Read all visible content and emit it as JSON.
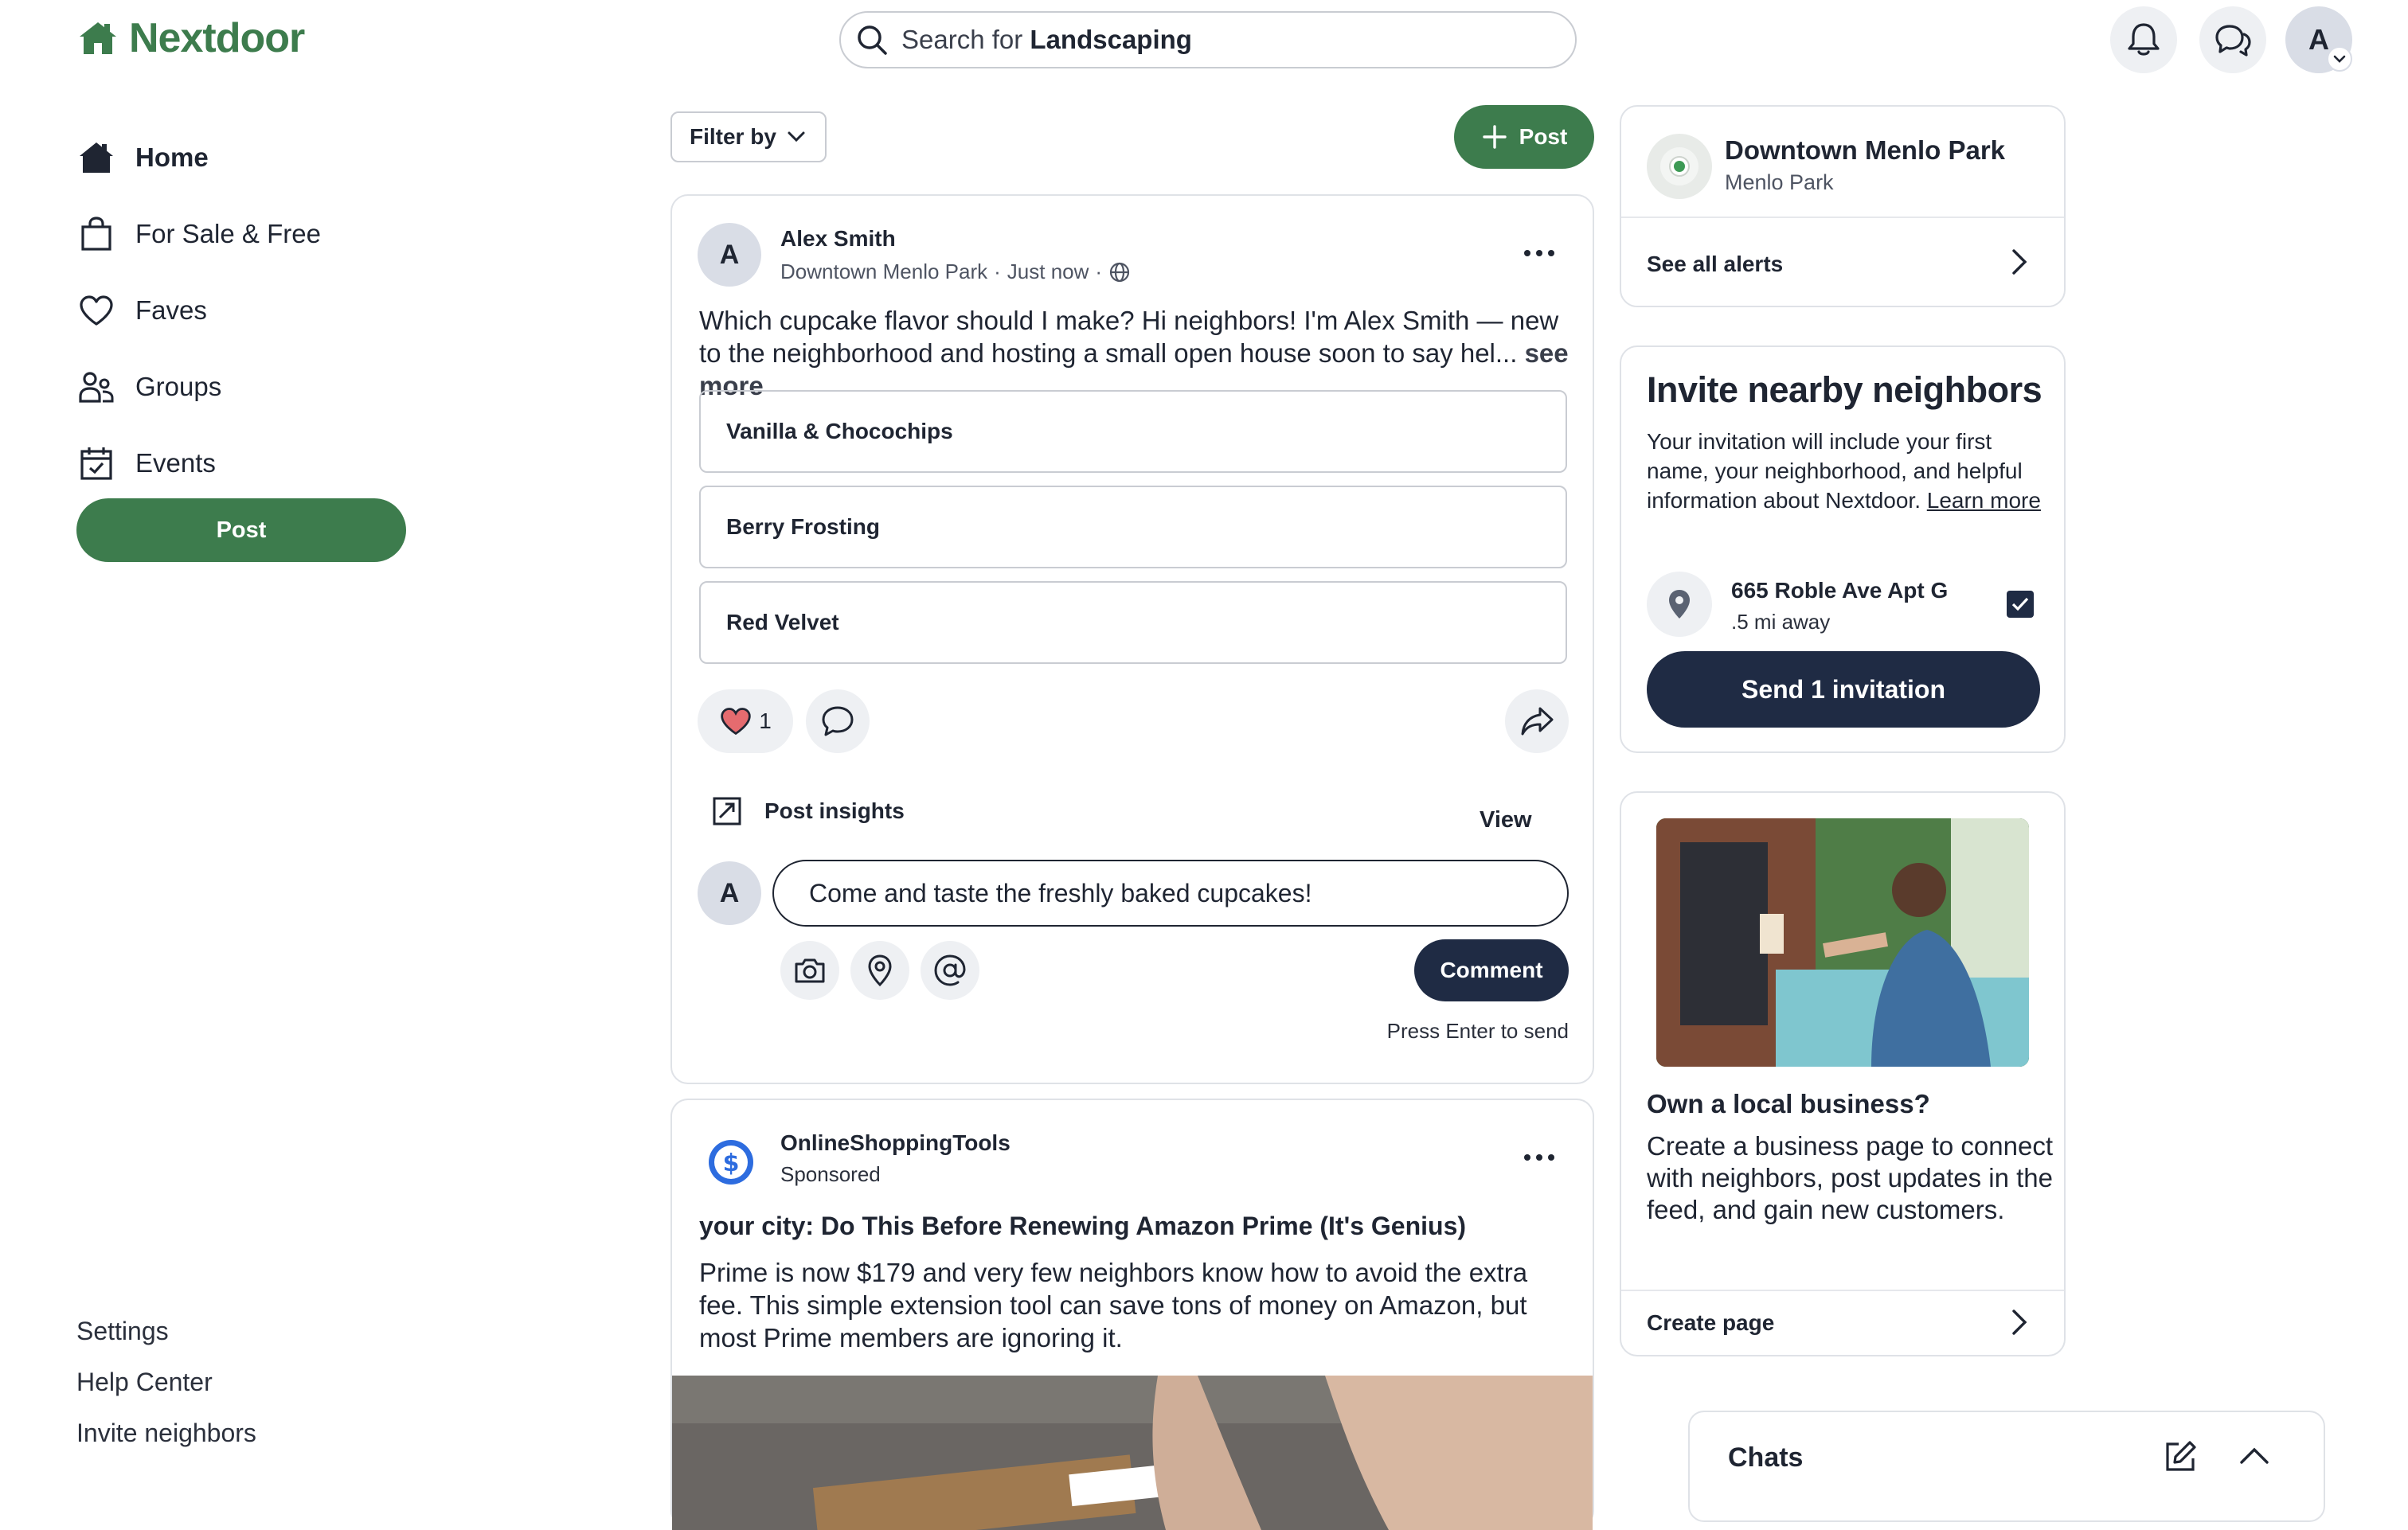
{
  "header": {
    "logo": "Nextdoor",
    "search_prefix": "Search for ",
    "search_term": "Landscaping",
    "avatar_initial": "A",
    "brand_color": "#3d7c4d"
  },
  "nav": {
    "items": [
      {
        "label": "Home",
        "icon": "home-icon"
      },
      {
        "label": "For Sale & Free",
        "icon": "shopping-bag-icon"
      },
      {
        "label": "Faves",
        "icon": "heart-icon"
      },
      {
        "label": "Groups",
        "icon": "groups-icon"
      },
      {
        "label": "Events",
        "icon": "calendar-icon"
      }
    ],
    "post_label": "Post",
    "footer": [
      "Settings",
      "Help Center",
      "Invite neighbors"
    ]
  },
  "feed": {
    "filter_label": "Filter by",
    "post_label": "Post",
    "post": {
      "avatar_initial": "A",
      "author": "Alex Smith",
      "neighborhood": "Downtown Menlo Park",
      "time": "Just now",
      "body": "Which cupcake flavor should I make? Hi neighbors! I'm Alex Smith — new to the neighborhood and hosting a small open house soon to say hel...",
      "see_more": "see more",
      "poll_options": [
        "Vanilla & Chocochips",
        "Berry Frosting",
        "Red Velvet"
      ],
      "reaction_count": "1",
      "insights_label": "Post insights",
      "view_label": "View",
      "comment_avatar": "A",
      "comment_text": "Come and taste the freshly baked cupcakes!",
      "comment_button": "Comment",
      "press_enter": "Press Enter to send"
    },
    "ad": {
      "advertiser": "OnlineShoppingTools",
      "sponsored": "Sponsored",
      "title": "your city: Do This Before Renewing Amazon Prime (It's Genius)",
      "body": "Prime is now $179 and very few neighbors know how to avoid the extra fee. This simple extension tool can save tons of money on Amazon, but most Prime members are ignoring it."
    }
  },
  "sidebar": {
    "alerts": {
      "title": "Downtown Menlo Park",
      "subtitle": "Menlo Park",
      "link": "See all alerts"
    },
    "invite": {
      "title": "Invite nearby neighbors",
      "desc": "Your invitation will include your first name, your neighborhood, and helpful information about Nextdoor. ",
      "learn_more": "Learn more",
      "address": "665 Roble Ave Apt G",
      "distance": ".5 mi away",
      "checked": true,
      "button": "Send 1 invitation"
    },
    "business": {
      "title": "Own a local business?",
      "desc": "Create a business page to connect with neighbors, post updates in the feed, and gain new customers.",
      "link": "Create page"
    }
  },
  "chats": {
    "label": "Chats"
  }
}
